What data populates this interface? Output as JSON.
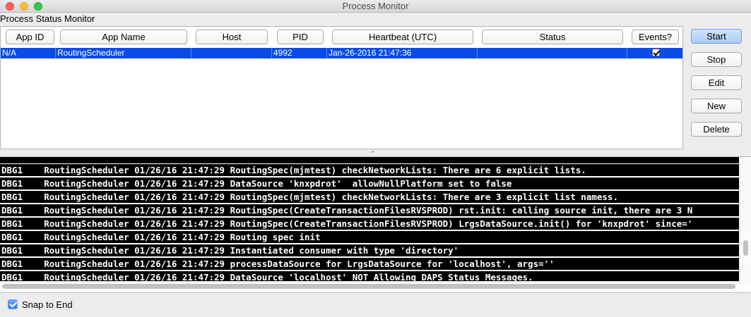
{
  "window": {
    "title": "Process Monitor"
  },
  "panel": {
    "title": "Process Status Monitor"
  },
  "table": {
    "columns": [
      "App ID",
      "App Name",
      "Host",
      "PID",
      "Heartbeat (UTC)",
      "Status",
      "Events?"
    ],
    "rows": [
      {
        "app_id": "N/A",
        "app_name": "RoutingScheduler",
        "host": "",
        "pid": "4992",
        "heartbeat": "Jan-26-2016 21:47:36",
        "status": "",
        "events": true
      }
    ]
  },
  "buttons": {
    "start": "Start",
    "stop": "Stop",
    "edit": "Edit",
    "new": "New",
    "delete": "Delete"
  },
  "log": {
    "lines": [
      "DBG1    RoutingScheduler 01/26/16 21:47:29 RoutingSpec(mjmtest) checkNetworkLists: There are 6 explicit lists.",
      "DBG1    RoutingScheduler 01/26/16 21:47:29 DataSource 'knxpdrot'  allowNullPlatform set to false",
      "DBG1    RoutingScheduler 01/26/16 21:47:29 RoutingSpec(mjmtest) checkNetworkLists: There are 3 explicit list namess.",
      "DBG1    RoutingScheduler 01/26/16 21:47:29 RoutingSpec(CreateTransactionFilesRVSPROD) rst.init: calling source init, there are 3 N",
      "DBG1    RoutingScheduler 01/26/16 21:47:29 RoutingSpec(CreateTransactionFilesRVSPROD) LrgsDataSource.init() for 'knxpdrot' since='",
      "DBG1    RoutingScheduler 01/26/16 21:47:29 Routing spec init",
      "DBG1    RoutingScheduler 01/26/16 21:47:29 Instantiated consumer with type 'directory'",
      "DBG1    RoutingScheduler 01/26/16 21:47:29 processDataSource for LrgsDataSource for 'localhost', args=''",
      "DBG1    RoutingScheduler 01/26/16 21:47:29 DataSource 'localhost' NOT Allowing DAPS Status Messages."
    ]
  },
  "footer": {
    "snap_label": "Snap to End",
    "snap_checked": true
  },
  "colors": {
    "selection": "#0b4ce6",
    "log_background": "#000000",
    "log_text": "#ffffff"
  }
}
